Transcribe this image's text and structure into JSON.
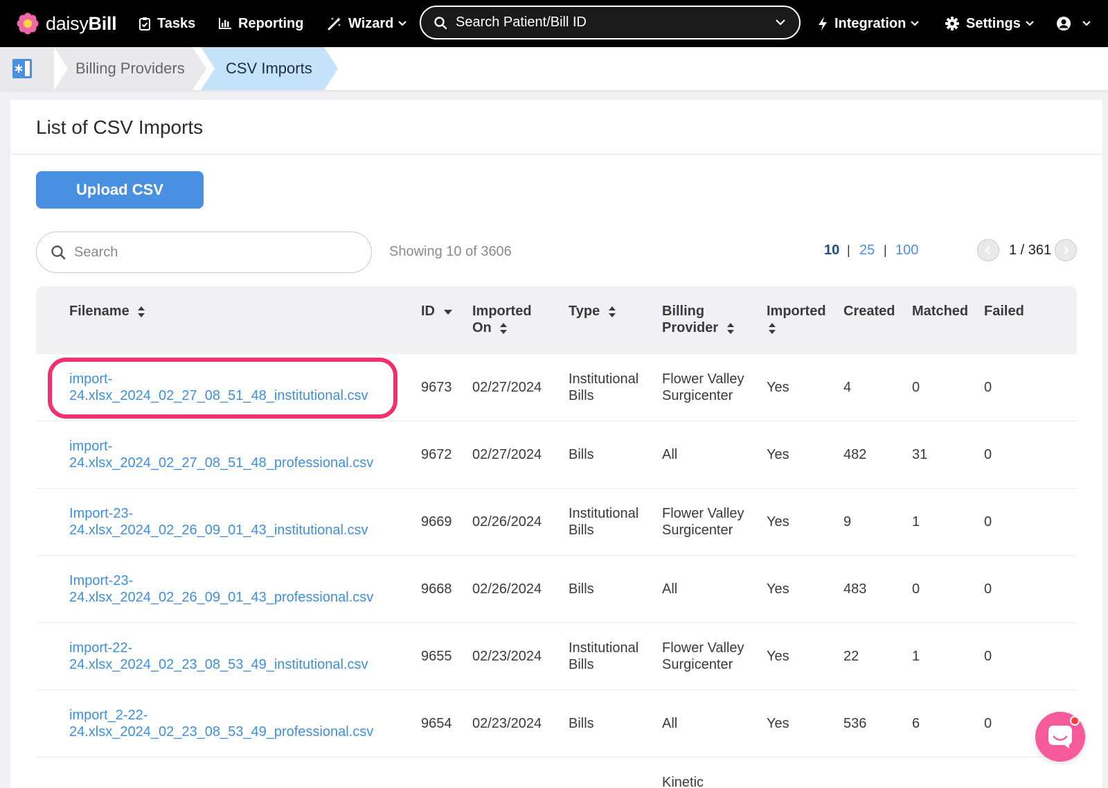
{
  "nav": {
    "logo_text_1": "daisy",
    "logo_text_2": "Bill",
    "tasks": "Tasks",
    "reporting": "Reporting",
    "wizard": "Wizard",
    "search_text": "Search Patient/Bill ID",
    "integration": "Integration",
    "settings": "Settings"
  },
  "breadcrumb": {
    "billing_providers": "Billing Providers",
    "csv_imports": "CSV Imports"
  },
  "page": {
    "title": "List of CSV Imports",
    "upload_button": "Upload CSV",
    "search_placeholder": "Search",
    "showing": "Showing 10 of 3606",
    "page_sizes": [
      "10",
      "25",
      "100"
    ],
    "page_sep": "|",
    "pagination": "1 / 361"
  },
  "table": {
    "headers": {
      "filename": "Filename",
      "id": "ID",
      "imported_on_1": "Imported",
      "imported_on_2": "On",
      "type": "Type",
      "billing_provider_1": "Billing",
      "billing_provider_2": "Provider",
      "imported": "Imported",
      "created": "Created",
      "matched": "Matched",
      "failed": "Failed"
    },
    "rows": [
      {
        "file_1": "import-",
        "file_2": "24.xlsx_2024_02_27_08_51_48_institutional.csv",
        "id": "9673",
        "date": "02/27/2024",
        "type_1": "Institutional",
        "type_2": "Bills",
        "prov_1": "Flower Valley",
        "prov_2": "Surgicenter",
        "imported": "Yes",
        "created": "4",
        "matched": "0",
        "failed": "0"
      },
      {
        "file_1": "import-",
        "file_2": "24.xlsx_2024_02_27_08_51_48_professional.csv",
        "id": "9672",
        "date": "02/27/2024",
        "type_1": "Bills",
        "type_2": "",
        "prov_1": "All",
        "prov_2": "",
        "imported": "Yes",
        "created": "482",
        "matched": "31",
        "failed": "0"
      },
      {
        "file_1": "Import-23-",
        "file_2": "24.xlsx_2024_02_26_09_01_43_institutional.csv",
        "id": "9669",
        "date": "02/26/2024",
        "type_1": "Institutional",
        "type_2": "Bills",
        "prov_1": "Flower Valley",
        "prov_2": "Surgicenter",
        "imported": "Yes",
        "created": "9",
        "matched": "1",
        "failed": "0"
      },
      {
        "file_1": "Import-23-",
        "file_2": "24.xlsx_2024_02_26_09_01_43_professional.csv",
        "id": "9668",
        "date": "02/26/2024",
        "type_1": "Bills",
        "type_2": "",
        "prov_1": "All",
        "prov_2": "",
        "imported": "Yes",
        "created": "483",
        "matched": "0",
        "failed": "0"
      },
      {
        "file_1": "import-22-",
        "file_2": "24.xlsx_2024_02_23_08_53_49_institutional.csv",
        "id": "9655",
        "date": "02/23/2024",
        "type_1": "Institutional",
        "type_2": "Bills",
        "prov_1": "Flower Valley",
        "prov_2": "Surgicenter",
        "imported": "Yes",
        "created": "22",
        "matched": "1",
        "failed": "0"
      },
      {
        "file_1": "import_2-22-",
        "file_2": "24.xlsx_2024_02_23_08_53_49_professional.csv",
        "id": "9654",
        "date": "02/23/2024",
        "type_1": "Bills",
        "type_2": "",
        "prov_1": "All",
        "prov_2": "",
        "imported": "Yes",
        "created": "536",
        "matched": "6",
        "failed": "0"
      }
    ],
    "partial_row_text": "Kinetic"
  },
  "colors": {
    "accent": "#4a90e2",
    "link": "#3d8fe0",
    "highlight": "#f2306f",
    "chat": "#f75a9a",
    "breadcrumb_active": "#c4e3fb"
  },
  "icons": [
    "daisy-logo-icon",
    "tasks-icon",
    "reporting-icon",
    "wizard-icon",
    "search-icon",
    "chevron-down-icon",
    "integration-icon",
    "settings-icon",
    "user-icon",
    "home-icon",
    "sort-icon",
    "chevron-left-icon",
    "chevron-right-icon",
    "chat-icon"
  ]
}
